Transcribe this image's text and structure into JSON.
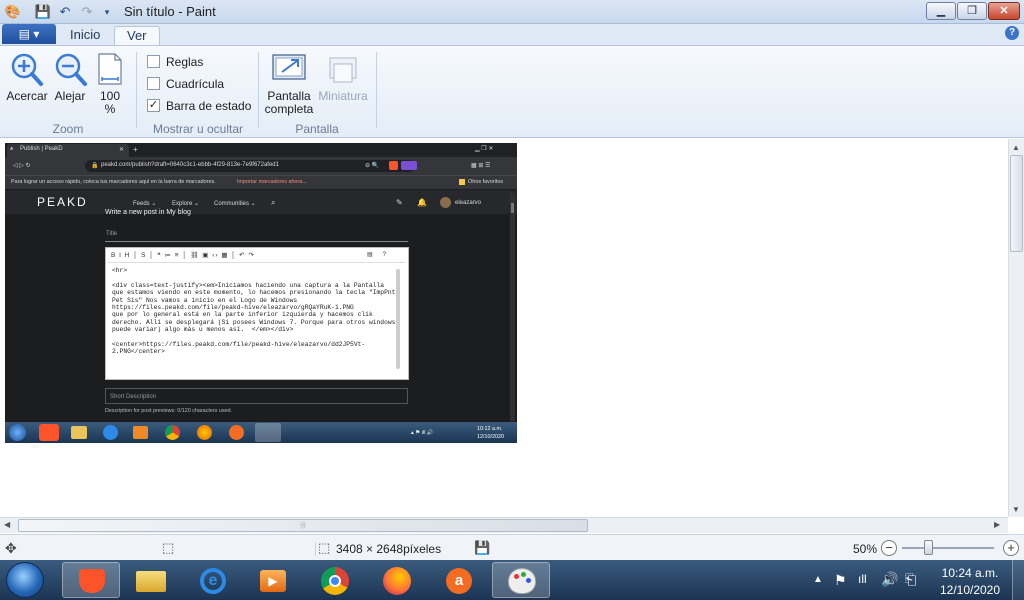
{
  "window": {
    "title": "Sin título - Paint"
  },
  "ribbon": {
    "tabs": [
      "Inicio",
      "Ver"
    ],
    "active_tab": "Ver",
    "zoom_group": {
      "label": "Zoom",
      "zoom_in": "Acercar",
      "zoom_out": "Alejar",
      "hundred_line1": "100",
      "hundred_line2": "%"
    },
    "show_group": {
      "label": "Mostrar u ocultar",
      "rulers": "Reglas",
      "rulers_checked": false,
      "grid": "Cuadrícula",
      "grid_checked": false,
      "statusbar": "Barra de estado",
      "statusbar_checked": true
    },
    "display_group": {
      "label": "Pantalla",
      "fullscreen_line1": "Pantalla",
      "fullscreen_line2": "completa",
      "thumbnail": "Miniatura"
    }
  },
  "screenshot": {
    "tab_title": "Publish | PeakD",
    "url": "peakd.com/publish?draft=0640c3c1-ebbb-4f29-813e-7e9f672afed1",
    "bookmarks_hint": "Para lograr un acceso rápido, coloca tus marcadores aquí en la barra de marcadores.",
    "bookmarks_link": "Importar marcadores ahora...",
    "other_bookmarks": "Otros favoritos",
    "site_logo": "PEAKD",
    "nav": [
      "Feeds ⌄",
      "Explore ⌄",
      "Communities ⌄"
    ],
    "username": "eleazarvo",
    "page_heading": "Write a new post in My blog",
    "title_placeholder": "Title",
    "editor_lines": [
      "<hr>",
      "",
      "<div class=text-justify><em>Iniciamos haciendo una captura a la Pantalla",
      "que estamos viendo en este momento, lo hacemos presionando la tecla \"ImpPnt",
      "Pet Sis\" Nos vamos a inicio en el Logo de Windows",
      "https://files.peakd.com/file/peakd-hive/eleazarvo/gRQaYRuK-1.PNG",
      "que por lo general está en la parte inferior izquierda y hacemos clik",
      "derecho. Allí se desplegará (Si posees Windows 7. Porque para otros windows",
      "puede variar) algo más u menos así.  </em></div>",
      "",
      "<center>https://files.peakd.com/file/peakd-hive/eleazarvo/dd2JP5Vt-",
      "2.PNG</center>"
    ],
    "short_desc_placeholder": "Short Description",
    "desc_hint": "Description for post previews: 0/120 characters used.",
    "clock_time": "10:12 a.m.",
    "clock_date": "12/10/2020"
  },
  "status": {
    "dimensions": "3408 × 2648píxeles",
    "zoom": "50%"
  },
  "taskbar": {
    "time": "10:24 a.m.",
    "date": "12/10/2020"
  },
  "colors": {
    "accent": "#2b5797",
    "ribbon": "#e4edf7",
    "taskbar": "#1c3452"
  }
}
